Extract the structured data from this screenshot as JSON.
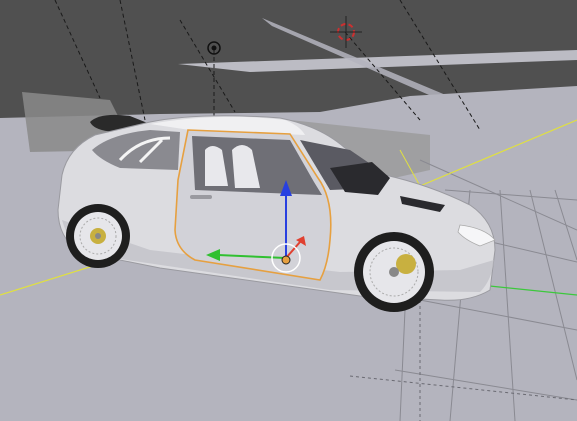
{
  "app": "3D Viewport",
  "scene": {
    "world_color": "#545454",
    "floor_color": "#b4b4be",
    "grid_color": "#8a8a92",
    "selection_outline_color": "#e6a040",
    "axis_x_color": "#e0e040",
    "axis_y_color": "#3cc83c",
    "object": "rally-hatchback-car"
  },
  "gizmo": {
    "axes": [
      "x-axis-handle",
      "y-axis-handle",
      "z-axis-handle"
    ],
    "x_color": "#e04030",
    "y_color": "#30c030",
    "z_color": "#2840e0",
    "center_color": "#ffffff"
  },
  "cursor_3d": {
    "ring_color": "#cc3030",
    "cross_color": "#222222"
  }
}
